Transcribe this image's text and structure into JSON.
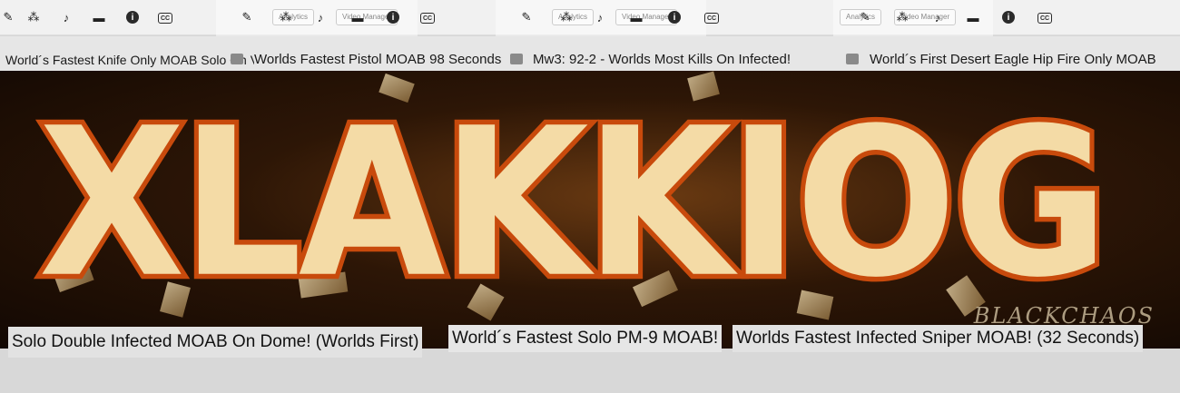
{
  "toolbar": {
    "ghost_tabs": [
      "Analytics",
      "Video Manager",
      "Analytics",
      "Video Manager",
      "Analytics",
      "Video Manager"
    ],
    "info_glyph": "i",
    "cc_glyph": "CC"
  },
  "titles": [
    "World´s Fastest Knife Only MOAB Solo On Village",
    "Worlds Fastest Pistol MOAB 98 Seconds",
    "Mw3: 92-2 - Worlds Most Kills On Infected!",
    "World´s First Desert Eagle Hip Fire Only MOAB"
  ],
  "banner": {
    "logo_text": "XLAKKIOG",
    "signature": "BLACKCHAOS"
  },
  "captions": [
    "Solo Double Infected MOAB On Dome! (Worlds First)",
    "World´s Fastest Solo PM-9 MOAB!",
    "Worlds Fastest Infected Sniper MOAB! (32 Seconds)"
  ],
  "colors": {
    "logo_fill": "#f4dba6",
    "logo_stroke": "#c84a0c",
    "banner_bg": "#2d1606"
  }
}
